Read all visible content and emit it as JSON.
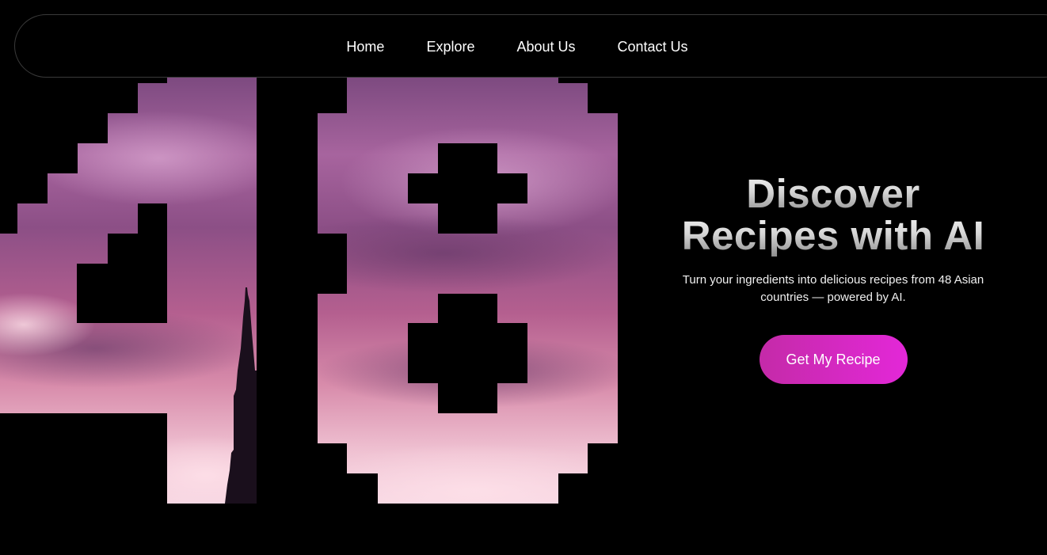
{
  "nav": {
    "items": [
      {
        "label": "Home"
      },
      {
        "label": "Explore"
      },
      {
        "label": "About Us"
      },
      {
        "label": "Contact Us"
      }
    ]
  },
  "hero": {
    "title_line1": "Discover",
    "title_line2": "Recipes with AI",
    "subtitle": "Turn your ingredients into delicious recipes from 48 Asian countries — powered by AI.",
    "cta_label": "Get My Recipe",
    "image_description_icon": "sunset-sky-minaret-image"
  },
  "colors": {
    "background": "#000000",
    "cta_start": "#c42aa8",
    "cta_end": "#e328d8",
    "sky_top": "#8c4f88",
    "sky_bottom": "#f2c9d8"
  }
}
